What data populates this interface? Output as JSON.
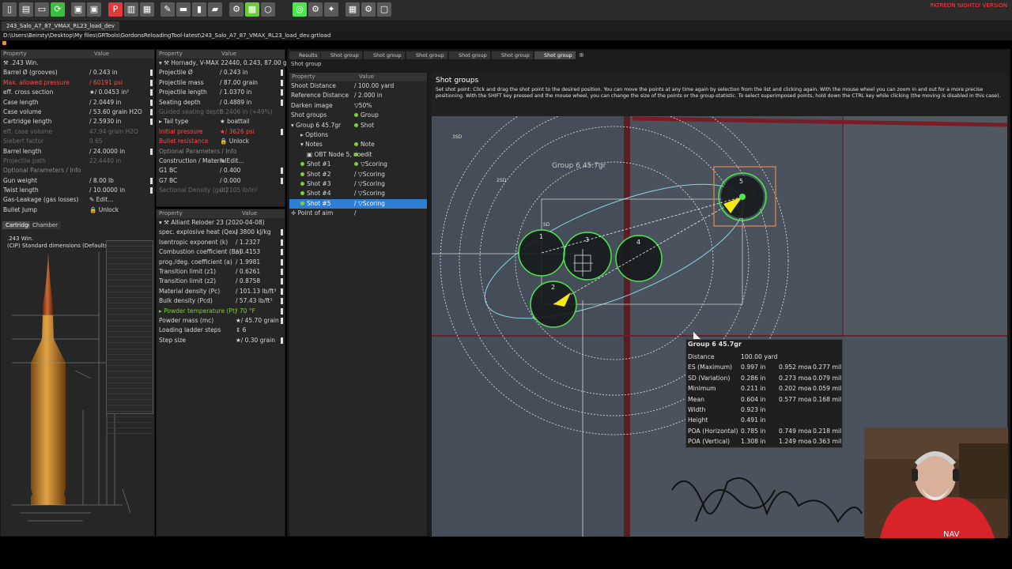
{
  "app": {
    "nightly_label": "PATREON NIGHTLY VERSION",
    "file_tab": "243_Salo_A7_87_VMAX_RL23_load_dev",
    "file_path": "D:\\Users\\Beirsty\\Desktop\\My files\\GRTools\\GordonsReloadingTool-latest\\243_Salo_A7_87_VMAX_RL23_load_dev.grtload",
    "accent_color": "#2e7fd4"
  },
  "toolbar_icons": [
    "new-file-icon",
    "open-file-icon",
    "open-folder-icon",
    "reload-icon",
    "save-icon",
    "save-as-icon",
    "pdf-icon",
    "report-icon",
    "print-icon",
    "tools-icon",
    "measure-icon",
    "cartridge-icon",
    "lock-icon",
    "settings-icon",
    "color-icon",
    "circle-icon",
    "target-icon",
    "gear-icon",
    "wrench-icon",
    "grid-icon",
    "config-icon",
    "window-icon"
  ],
  "cartridge_panel": {
    "col_property": "Property",
    "col_value": "Value",
    "group_label": ".243 Win.",
    "rows": [
      {
        "k": "Barrel Ø (grooves)",
        "v": "0.243 in",
        "kstyle": "",
        "vprefix": "/"
      },
      {
        "k": "Max. allowed pressure",
        "v": "60191 psi",
        "kstyle": "red",
        "vprefix": "/",
        "vstyle": "red"
      },
      {
        "k": "eff. cross section",
        "v": "0.0453 in²",
        "kstyle": "",
        "vprefix": "★/"
      },
      {
        "k": "Case length",
        "v": "2.0449 in",
        "kstyle": "",
        "vprefix": "/"
      },
      {
        "k": "Case volume",
        "v": "53.60 grain H2O",
        "kstyle": "",
        "vprefix": "/"
      },
      {
        "k": "Cartridge length",
        "v": "2.5930 in",
        "kstyle": "",
        "vprefix": "/"
      },
      {
        "k": "eff. case volume",
        "v": "47.94 grain H2O",
        "kstyle": "dim",
        "vprefix": "",
        "vstyle": "dim"
      },
      {
        "k": "Siebert factor",
        "v": "0.65",
        "kstyle": "dim",
        "vprefix": "",
        "vstyle": "dim"
      },
      {
        "k": "Barrel length",
        "v": "24.0000 in",
        "kstyle": "",
        "vprefix": "/"
      },
      {
        "k": "Projectile path",
        "v": "22.4440 in",
        "kstyle": "dim",
        "vprefix": "",
        "vstyle": "dim"
      },
      {
        "k": "Optional Parameters / Info",
        "v": "",
        "kstyle": "sec",
        "vprefix": ""
      },
      {
        "k": "Gun weight",
        "v": "8.00 lb",
        "kstyle": "",
        "vprefix": "/"
      },
      {
        "k": "Twist length",
        "v": "10.0000 in",
        "kstyle": "",
        "vprefix": "/"
      },
      {
        "k": "Gas-Leakage (gas losses)",
        "v": "Edit...",
        "kstyle": "",
        "vprefix": "✎"
      },
      {
        "k": "Bullet Jump",
        "v": "Unlock",
        "kstyle": "",
        "vprefix": "🔒"
      }
    ],
    "tabs": [
      "Cartridge",
      "Chamber"
    ],
    "drawing_title": ".243 Win.",
    "drawing_subtitle": "(CIP) Standard dimensions (Defaults)"
  },
  "projectile_panel": {
    "col_property": "Property",
    "col_value": "Value",
    "group_label": "Hornady, V-MAX 22440, 0.243, 87.00 gr",
    "rows": [
      {
        "k": "Projectile Ø",
        "v": "0.243 in",
        "kstyle": "",
        "vprefix": "/"
      },
      {
        "k": "Projectile mass",
        "v": "87.00 grain",
        "kstyle": "",
        "vprefix": "/"
      },
      {
        "k": "Projectile length",
        "v": "1.0370 in",
        "kstyle": "",
        "vprefix": "/"
      },
      {
        "k": "Seating depth",
        "v": "0.4889 in",
        "kstyle": "",
        "vprefix": "/"
      },
      {
        "k": "Guided seating depth",
        "v": "0.2406 in (+49%)",
        "kstyle": "dim",
        "vprefix": "",
        "vstyle": "dim"
      },
      {
        "k": "▸ Tail type",
        "v": "boattail",
        "kstyle": "",
        "vprefix": "★"
      },
      {
        "k": "Initial pressure",
        "v": "3626 psi",
        "kstyle": "red",
        "vprefix": "★/",
        "vstyle": "red"
      },
      {
        "k": "Bullet resistance",
        "v": "Unlock",
        "kstyle": "red",
        "vprefix": "🔒"
      },
      {
        "k": "Optional Parameters / Info",
        "v": "",
        "kstyle": "sec",
        "vprefix": ""
      },
      {
        "k": "Construction / Material",
        "v": "Edit...",
        "kstyle": "",
        "vprefix": "✎"
      },
      {
        "k": "G1 BC",
        "v": "0.400",
        "kstyle": "",
        "vprefix": "/"
      },
      {
        "k": "G7 BC",
        "v": "0.000",
        "kstyle": "",
        "vprefix": "/"
      },
      {
        "k": "Sectional Density (gsd)",
        "v": "0.2105 lb/in²",
        "kstyle": "dim",
        "vprefix": "",
        "vstyle": "dim"
      }
    ]
  },
  "powder_panel": {
    "col_property": "Property",
    "col_value": "Value",
    "group_label": "Alliant Reloder 23 (2020-04-08)",
    "rows": [
      {
        "k": "spec. explosive heat (Qex)",
        "v": "3800 kJ/kg",
        "kstyle": "",
        "vprefix": "/"
      },
      {
        "k": "Isentropic exponent (k)",
        "v": "1.2327",
        "kstyle": "",
        "vprefix": "/"
      },
      {
        "k": "Combustion coefficient (Ba)",
        "v": "0.4153",
        "kstyle": "",
        "vprefix": "/"
      },
      {
        "k": "prog./deg. coefficient (a)",
        "v": "1.9981",
        "kstyle": "",
        "vprefix": "/"
      },
      {
        "k": "Transition limit (z1)",
        "v": "0.6261",
        "kstyle": "",
        "vprefix": "/"
      },
      {
        "k": "Transition limit (z2)",
        "v": "0.8758",
        "kstyle": "",
        "vprefix": "/"
      },
      {
        "k": "Material density (Pc)",
        "v": "101.13 lb/ft³",
        "kstyle": "",
        "vprefix": "/"
      },
      {
        "k": "Bulk density (Pcd)",
        "v": "57.43 lb/ft³",
        "kstyle": "",
        "vprefix": "/"
      },
      {
        "k": "▸ Powder temperature (Pt)",
        "v": "70 °F",
        "kstyle": "green",
        "vprefix": "/",
        "vstyle": "green"
      },
      {
        "k": "Powder mass (mc)",
        "v": "45.70 grain",
        "kstyle": "",
        "vprefix": "★/"
      },
      {
        "k": "Loading ladder steps",
        "v": "6",
        "kstyle": "",
        "vprefix": "⇕"
      },
      {
        "k": "Step size",
        "v": "0.30 grain",
        "kstyle": "",
        "vprefix": "★/"
      }
    ]
  },
  "results_tabs": [
    "Results",
    "Shot group",
    "Shot group",
    "Shot group",
    "Shot group",
    "Shot group",
    "Shot group"
  ],
  "shot_panel": {
    "section_label": "Shot group",
    "col_property": "Property",
    "col_value": "Value",
    "rows": [
      {
        "k": "Shoot Distance",
        "v": "/ 100.00 yard",
        "indent": 2
      },
      {
        "k": "Reference Distance",
        "v": "/ 2.000 in",
        "indent": 2
      },
      {
        "k": "Darken image",
        "v": "▽50%",
        "indent": 2
      },
      {
        "k": "Shot groups",
        "v": "Group",
        "indent": 2,
        "dot": true
      },
      {
        "k": "▾ Group 6 45.7gr",
        "v": "Shot",
        "indent": 2,
        "dot": true
      },
      {
        "k": "▸ Options",
        "v": "",
        "indent": 14
      },
      {
        "k": "▾ Notes",
        "v": "Note",
        "indent": 14,
        "dot": true
      },
      {
        "k": "▣ OBT Node 5, no",
        "v": "edit",
        "indent": 22,
        "dot": true
      },
      {
        "k": "Shot #1",
        "v": "▽Scoring",
        "indent": 14,
        "dot": true,
        "kdot": true
      },
      {
        "k": "Shot #2",
        "v": "▽Scoring",
        "indent": 14,
        "dot": false,
        "kdot": true
      },
      {
        "k": "Shot #3",
        "v": "▽Scoring",
        "indent": 14,
        "dot": false,
        "kdot": true
      },
      {
        "k": "Shot #4",
        "v": "▽Scoring",
        "indent": 14,
        "dot": false,
        "kdot": true
      },
      {
        "k": "Shot #5",
        "v": "▽Scoring",
        "indent": 14,
        "dot": false,
        "kdot": true,
        "sel": true
      },
      {
        "k": "✛ Point of aim",
        "v": "/",
        "indent": 2
      }
    ]
  },
  "target": {
    "title": "Shot groups",
    "help": "Set shot point: Click and drag the shot point to the desired position. You can move the points at any time again by selection from the list and clicking again. With the mouse wheel you can zoom in and out for a more precise positioning. With the SHIFT key pressed and the mouse wheel, you can change the size of the points or the group-statistic. To select superimposed points, hold down the CTRL key while clicking (the moving is disabled in this case).",
    "group_label": "Group 6 45.7gr",
    "ring_labels": [
      "3SD",
      "2SD",
      "SD"
    ],
    "shot_labels": [
      "1",
      "2",
      "3",
      "4",
      "5"
    ]
  },
  "stats": {
    "title": "Group 6 45.7gr",
    "rows": [
      {
        "k": "Distance",
        "a": "100.00 yard",
        "b": "",
        "c": ""
      },
      {
        "k": "ES (Maximum)",
        "a": "0.997 in",
        "b": "0.952 moa",
        "c": "0.277 mil"
      },
      {
        "k": "SD (Variation)",
        "a": "0.286 in",
        "b": "0.273 moa",
        "c": "0.079 mil"
      },
      {
        "k": "Minimum",
        "a": "0.211 in",
        "b": "0.202 moa",
        "c": "0.059 mil"
      },
      {
        "k": "Mean",
        "a": "0.604 in",
        "b": "0.577 moa",
        "c": "0.168 mil"
      },
      {
        "k": "Width",
        "a": "0.923 in",
        "b": "",
        "c": ""
      },
      {
        "k": "Height",
        "a": "0.491 in",
        "b": "",
        "c": ""
      },
      {
        "k": "POA (Horizontal)",
        "a": "0.785 in",
        "b": "0.749 moa",
        "c": "0.218 mil"
      },
      {
        "k": "POA (Vertical)",
        "a": "1.308 in",
        "b": "1.249 moa",
        "c": "0.363 mil"
      }
    ]
  },
  "webcam_text": "NAV"
}
